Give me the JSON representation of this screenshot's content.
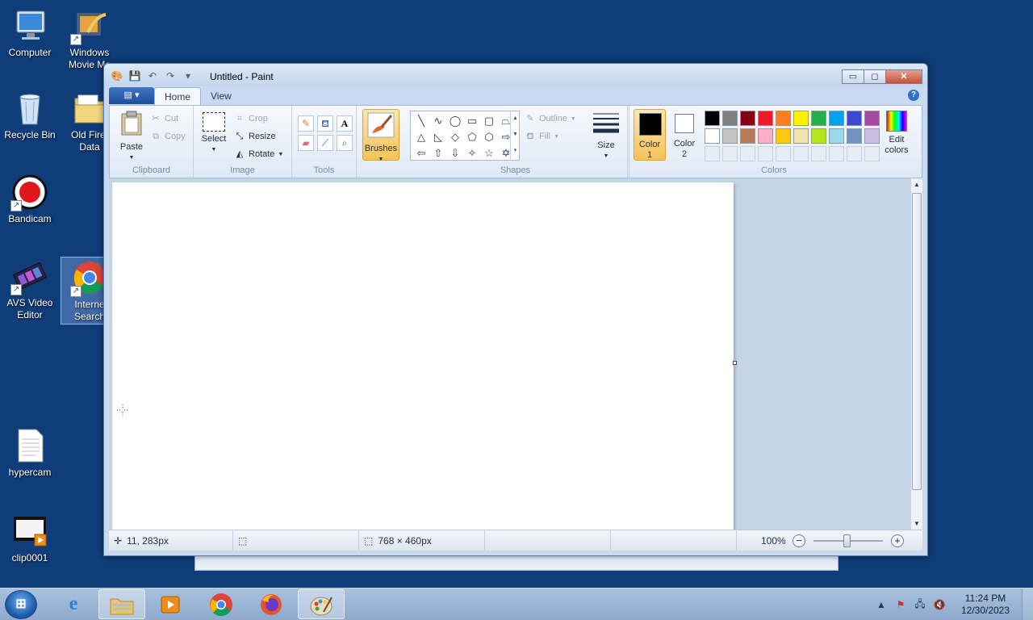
{
  "desktop": {
    "icons": [
      {
        "label": "Computer"
      },
      {
        "label": "Windows Movie Ma"
      },
      {
        "label": "Recycle Bin"
      },
      {
        "label": "Old Firef Data"
      },
      {
        "label": "Bandicam"
      },
      {
        "label": "AVS Video Editor"
      },
      {
        "label": "Interne Search"
      },
      {
        "label": "hypercam"
      },
      {
        "label": "clip0001"
      }
    ]
  },
  "window": {
    "title": "Untitled - Paint",
    "controls": {
      "minimize": "▭",
      "maximize": "◻",
      "close": "✕"
    }
  },
  "ribbon": {
    "file_tab": "▤ ▾",
    "tabs": [
      {
        "label": "Home"
      },
      {
        "label": "View"
      }
    ],
    "help": "?",
    "clipboard": {
      "paste": "Paste",
      "cut": "Cut",
      "copy": "Copy",
      "group": "Clipboard"
    },
    "image": {
      "select": "Select",
      "crop": "Crop",
      "resize": "Resize",
      "rotate": "Rotate",
      "group": "Image"
    },
    "tools": {
      "group": "Tools"
    },
    "brushes": {
      "label": "Brushes"
    },
    "shapes": {
      "outline": "Outline",
      "fill": "Fill",
      "group": "Shapes"
    },
    "size": {
      "label": "Size"
    },
    "colors": {
      "color1_label": "Color",
      "color1_num": "1",
      "color2_label": "Color",
      "color2_num": "2",
      "edit_label": "Edit",
      "edit_label2": "colors",
      "group": "Colors",
      "color1": "#000000",
      "color2": "#ffffff",
      "palette_row1": [
        "#000000",
        "#7f7f7f",
        "#880015",
        "#ed1c24",
        "#ff7f27",
        "#fff200",
        "#22b14c",
        "#00a2e8",
        "#3f48cc",
        "#a349a4"
      ],
      "palette_row2": [
        "#ffffff",
        "#c3c3c3",
        "#b97a57",
        "#ffaec9",
        "#ffc90e",
        "#efe4b0",
        "#b5e61d",
        "#99d9ea",
        "#7092be",
        "#c8bfe7"
      ]
    }
  },
  "status": {
    "cursor_pos": "11, 283px",
    "canvas_size": "768 × 460px",
    "zoom": "100%"
  },
  "taskbar": {
    "time": "11:24 PM",
    "date": "12/30/2023"
  }
}
